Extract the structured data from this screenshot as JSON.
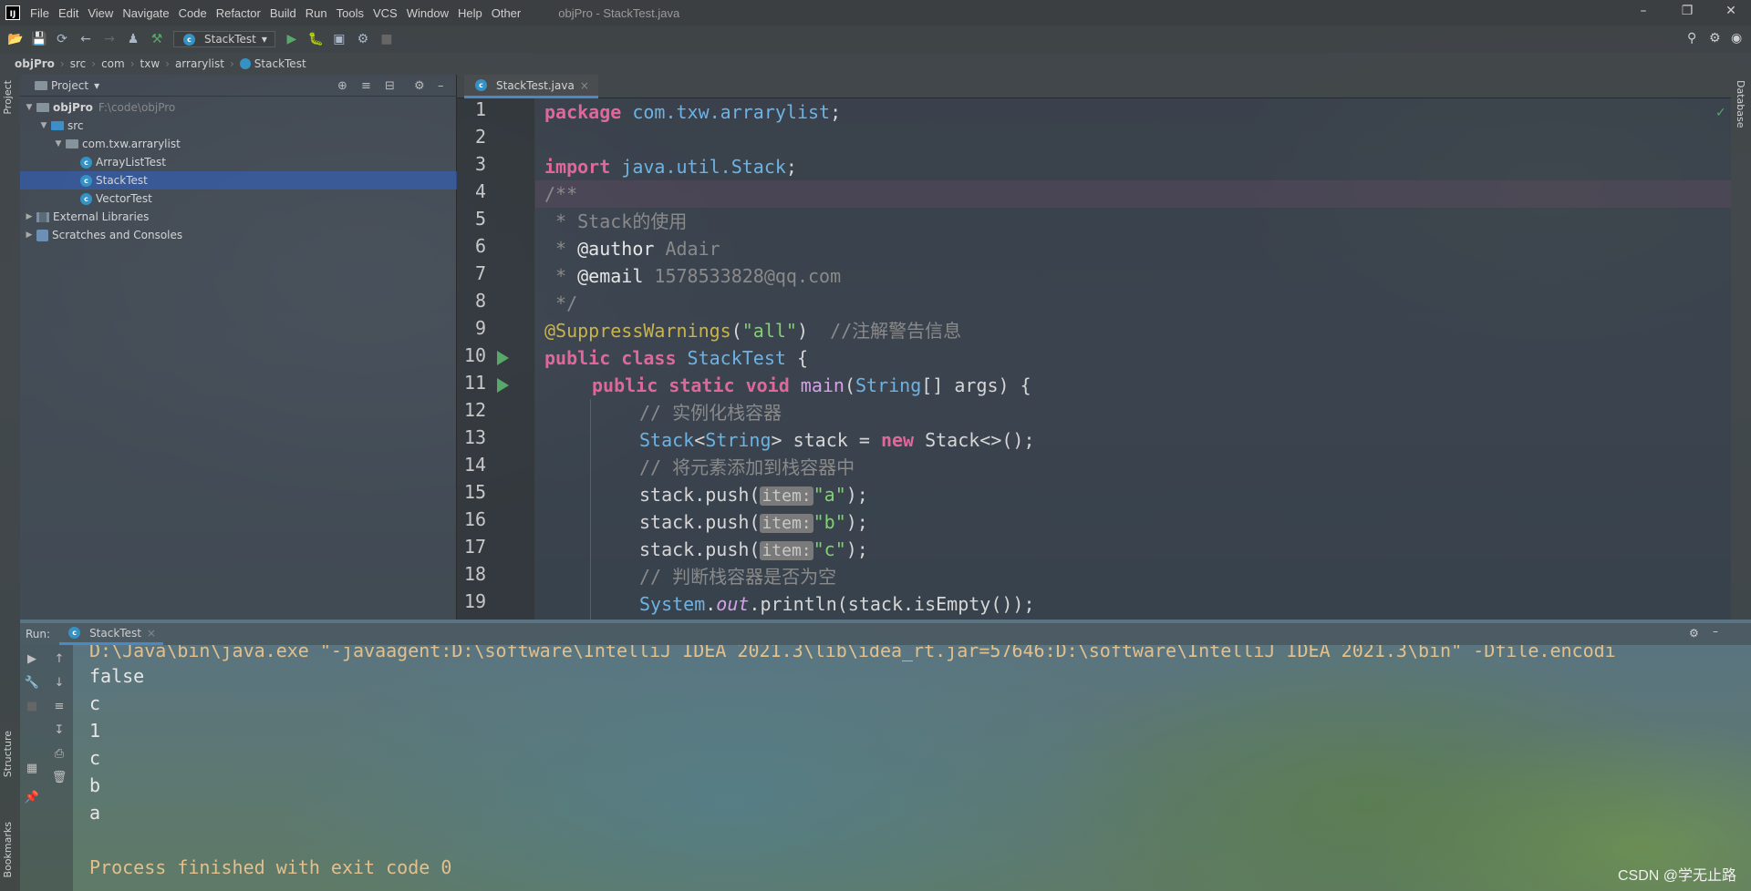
{
  "window": {
    "title": "objPro - StackTest.java",
    "logo": "IJ",
    "menu": [
      "File",
      "Edit",
      "View",
      "Navigate",
      "Code",
      "Refactor",
      "Build",
      "Run",
      "Tools",
      "VCS",
      "Window",
      "Help",
      "Other"
    ]
  },
  "toolbar": {
    "run_config": "StackTest"
  },
  "breadcrumb": [
    "objPro",
    "src",
    "com",
    "txw",
    "arrarylist",
    "StackTest"
  ],
  "side_tabs": {
    "left_top": "Project",
    "left_bottom_1": "Structure",
    "left_bottom_2": "Bookmarks",
    "right": "Database"
  },
  "project": {
    "header": "Project",
    "root_name": "objPro",
    "root_path": "F:\\code\\objPro",
    "src": "src",
    "package": "com.txw.arrarylist",
    "files": [
      "ArrayListTest",
      "StackTest",
      "VectorTest"
    ],
    "selected": "StackTest",
    "external": "External Libraries",
    "scratches": "Scratches and Consoles"
  },
  "editor": {
    "tab_label": "StackTest.java",
    "line_numbers": [
      "1",
      "2",
      "3",
      "4",
      "5",
      "6",
      "7",
      "8",
      "9",
      "10",
      "11",
      "12",
      "13",
      "14",
      "15",
      "16",
      "17",
      "18",
      "19"
    ],
    "hint_label": "item:",
    "line1": {
      "kw": "package",
      "pkg": "com.txw.arrarylist",
      "end": ";"
    },
    "line3": {
      "kw": "import",
      "pkg": "java.util.Stack",
      "end": ";"
    },
    "line4": "/**",
    "line5": " * Stack的使用",
    "line6": {
      "prefix": " * ",
      "tag": "@author",
      "rest": " Adair"
    },
    "line7": {
      "prefix": " * ",
      "tag": "@email",
      "rest": " 1578533828@qq.com"
    },
    "line8": " */",
    "line9": {
      "ann": "@SuppressWarnings",
      "open": "(",
      "str": "\"all\"",
      "close": ")",
      "comment": "  //注解警告信息"
    },
    "line10": {
      "kw": "public class ",
      "cls": "StackTest",
      "rest": " {"
    },
    "line11": {
      "kw": "public static void ",
      "fn": "main",
      "open": "(",
      "cls": "String",
      "rest": "[] args) {"
    },
    "line12": "// 实例化栈容器",
    "line13": {
      "cls1": "Stack",
      "lt": "<",
      "cls2": "String",
      "mid": "> stack = ",
      "kw": "new",
      "rest": " Stack<>();"
    },
    "line14": "// 将元素添加到栈容器中",
    "line15": {
      "pre": "stack.push(",
      "str": "\"a\"",
      "end": ");"
    },
    "line16": {
      "pre": "stack.push(",
      "str": "\"b\"",
      "end": ");"
    },
    "line17": {
      "pre": "stack.push(",
      "str": "\"c\"",
      "end": ");"
    },
    "line18": "// 判断栈容器是否为空",
    "line19": {
      "cls": "System",
      "dot": ".",
      "field": "out",
      "rest": ".println(stack.isEmpty());"
    }
  },
  "run": {
    "label": "Run:",
    "tab": "StackTest",
    "command": "D:\\Java\\bin\\java.exe \"-javaagent:D:\\software\\IntelliJ IDEA 2021.3\\lib\\idea_rt.jar=57646:D:\\software\\IntelliJ IDEA 2021.3\\bin\" -Dfile.encodi",
    "output": [
      "false",
      "c",
      "1",
      "c",
      "b",
      "a"
    ],
    "exit_message": "Process finished with exit code 0"
  },
  "watermark": "CSDN @学无止路",
  "colors": {
    "keyword": "#e0679a",
    "string": "#7fd26f",
    "comment": "#8a8a8a",
    "annotation": "#c9b34b",
    "type": "#6cb3e4",
    "selection": "#2f65ca",
    "run_green": "#59a869"
  }
}
